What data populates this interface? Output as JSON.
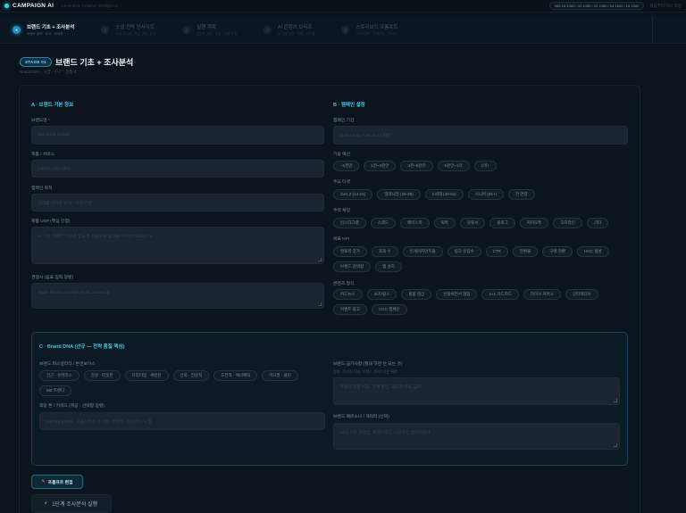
{
  "header": {
    "app_name": "CAMPAIGN AI",
    "tagline": "Generative Creative Intelligence",
    "size_formats": "960·16·1080 / 32·1080 / 32·1080 / 64·1600 / 16·1080",
    "reset_label": "처음부터 다시 작성"
  },
  "steps": [
    {
      "label": "브랜드 기초 + 조사분석",
      "sub": "브랜드 정보 · 조사 · 리서치",
      "active": true
    },
    {
      "label": "소셜 전략 인사이트",
      "sub": "소셜 미디어 · 채널 전략 · 분석",
      "active": false
    },
    {
      "label": "실행 계획",
      "sub": "콘텐츠 계획 · 일정 · 실행 단계",
      "active": false
    },
    {
      "label": "AI 콘텐츠 브리프",
      "sub": "AI 자동 생성 · 카피 · 비주얼",
      "active": false
    },
    {
      "label": "스토리보드 프롬프트",
      "sub": "스토리보드 · 프롬프트 · 이미지",
      "active": false
    }
  ],
  "page": {
    "stage_badge": "STAGE 01",
    "title": "브랜드 기초 + 조사분석",
    "subtitle": "Brand DNA · 시장 · 인구 · 경쟁사"
  },
  "section_a": {
    "title": "A · 브랜드 기본 정보",
    "brand_label": "브랜드명 *",
    "brand_placeholder": "Samsung Galaxy",
    "product_label": "제품 / 서비스",
    "product_placeholder": "Galaxy S25 Ultra",
    "goal_label": "캠페인 목적",
    "goal_placeholder": "신제품 인지도 확대 · 구매 전환",
    "usp_label": "제품 USP (핵심 강점)",
    "usp_placeholder": "AI 기반 카메라 기능과 압도적 성능으로 일상을 바꾸는 Galaxy AI",
    "competitor_label": "경쟁사 (쉼표 입력 정렬)",
    "competitor_placeholder": "Apple iPhone, Google Pixel, Xiaomi 등"
  },
  "section_b": {
    "title": "B · 캠페인 설정",
    "period_label": "캠페인 기간",
    "period_placeholder": "2025.05.01 ~ 06.30 (2개월)",
    "budget_label": "가용 예산",
    "budget_options": [
      "~1천만",
      "1천~3천만",
      "3천~5천만",
      "5천만~1억",
      "1억+"
    ],
    "target_label": "주요 타겟",
    "target_options": [
      "Gen Z (14-24)",
      "밀레니얼 (25-39)",
      "X세대 (40-54)",
      "시니어 (55+)",
      "전 연령"
    ],
    "channel_label": "주력 채널",
    "channel_options": [
      "인스타그램",
      "스레드",
      "페이스북",
      "틱톡",
      "유튜브",
      "블로그",
      "카카오톡",
      "오프라인",
      "기타"
    ],
    "kpi_label": "목표 KPI",
    "kpi_options": [
      "팔로워 증가",
      "조회 수",
      "인게이지먼트율",
      "링크 유입수",
      "CTR",
      "전환율",
      "구매 전환",
      "UGC 생성",
      "브랜드 검색량",
      "앱 설치"
    ],
    "content_label": "콘텐츠 형식",
    "content_options": [
      "카드뉴스",
      "쇼츠/릴스",
      "롱폼 영상",
      "인플루언서 협업",
      "1×1 카드피드",
      "라이브 커머스",
      "인터랙티브",
      "이벤트 광고",
      "UGC 캠페인"
    ]
  },
  "section_c": {
    "title": "C · Brand DNA (선규 — 전략 품질 핵심)",
    "personality_label": "브랜드 퍼스널리티 / 톤앤보이스",
    "personality_options": [
      "친근 · 유머러스",
      "감성 · 따뜻한",
      "프리미엄 · 세련된",
      "신뢰 · 전문적",
      "도전적 · 에너제틱",
      "미니멀 · 클린",
      "MZ 트렌디"
    ],
    "ban_label": "브랜드 금기사항 (절대 하면 안 되는 것)",
    "ban_hint": "법적 · 윤리적 이슈, 브랜드 가이드라인 위반",
    "ban_placeholder": "경쟁사 직접 비교, 가격 할인, 과도한 약속 금지",
    "wish_label": "희망 톤 / 키워드 (제공 · 선택형 정렬)",
    "wish_placeholder": "Samsung Blue, 고급스러운 미니멀, 미래적 · 혁신적인 느낌",
    "persona_label": "브랜드 페르소나 / 캐릭터 (선택)",
    "persona_placeholder": "30대 초반 직장인, 트렌디하고 스마트한 얼리어답터"
  },
  "actions": {
    "prompt_edit_label": "프롬프트 편집",
    "run_label": "1단계 조사분석 실행"
  },
  "colors": {
    "accent": "#3cc9e6",
    "background": "#0b131c",
    "highlight": "#f2a33a"
  }
}
